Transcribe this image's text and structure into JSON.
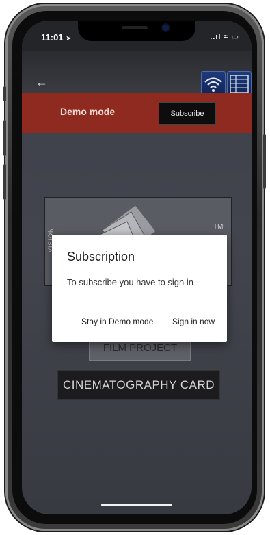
{
  "status_bar": {
    "time": "11:01",
    "indicators": "..ıl ≈ ▭",
    "icons": [
      "location-arrow-icon",
      "signal-icon",
      "wifi-icon",
      "battery-icon"
    ]
  },
  "nav": {
    "back_icon": "back-arrow-icon",
    "back_glyph": "←",
    "wifi_button_icon": "wifi-icon",
    "table_button_icon": "table-grid-icon"
  },
  "banner": {
    "demo_label": "Demo mode",
    "subscribe_label": "Subscribe",
    "color": "#8e2a1f"
  },
  "logo": {
    "vertical_text": "VISION",
    "tm": "TM"
  },
  "buttons": {
    "film_project": "FILM PROJECT",
    "cinematography_card": "CINEMATOGRAPHY CARD"
  },
  "dialog": {
    "title": "Subscription",
    "message": "To subscribe you have to sign in",
    "stay_label": "Stay in Demo mode",
    "signin_label": "Sign in now"
  }
}
